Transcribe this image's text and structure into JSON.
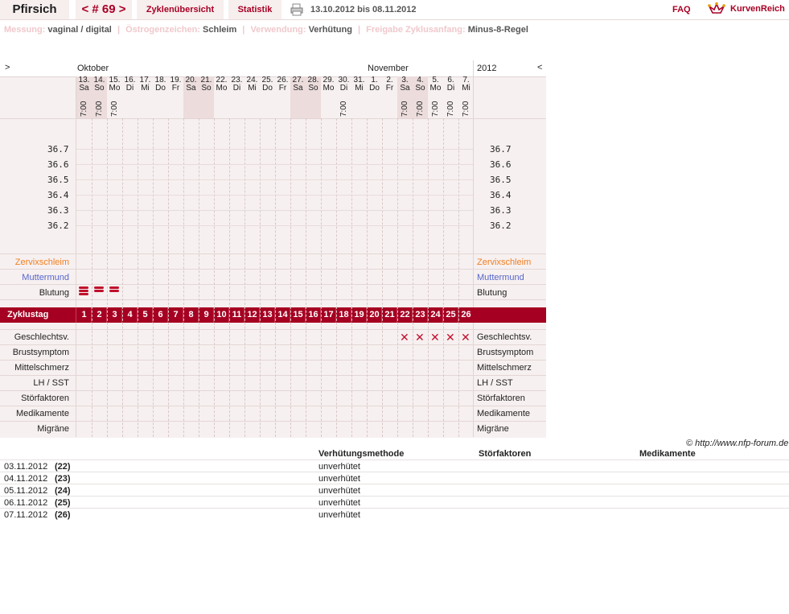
{
  "header": {
    "user": "Pfirsich",
    "cycle": "< # 69 >",
    "tab_overview": "Zyklenübersicht",
    "tab_stats": "Statistik",
    "date_range": "13.10.2012 bis 08.11.2012",
    "faq": "FAQ",
    "brand": "KurvenReich"
  },
  "meta": {
    "messung_label": "Messung:",
    "messung_value": "vaginal / digital",
    "oestrogen_label": "Östrogenzeichen:",
    "oestrogen_value": "Schleim",
    "verwendung_label": "Verwendung:",
    "verwendung_value": "Verhütung",
    "freigabe_label": "Freigabe Zyklusanfang:",
    "freigabe_value": "Minus-8-Regel"
  },
  "chart": {
    "nav_prev": ">",
    "nav_next": "<",
    "month1": "Oktober",
    "month2": "November",
    "year": "2012",
    "days": [
      {
        "d": "13.",
        "w": "Sa",
        "t": "7:00",
        "we": true
      },
      {
        "d": "14.",
        "w": "So",
        "t": "7:00",
        "we": true
      },
      {
        "d": "15.",
        "w": "Mo",
        "t": "7:00",
        "we": false
      },
      {
        "d": "16.",
        "w": "Di",
        "t": "",
        "we": false
      },
      {
        "d": "17.",
        "w": "Mi",
        "t": "",
        "we": false
      },
      {
        "d": "18.",
        "w": "Do",
        "t": "",
        "we": false
      },
      {
        "d": "19.",
        "w": "Fr",
        "t": "",
        "we": false
      },
      {
        "d": "20.",
        "w": "Sa",
        "t": "",
        "we": true
      },
      {
        "d": "21.",
        "w": "So",
        "t": "",
        "we": true
      },
      {
        "d": "22.",
        "w": "Mo",
        "t": "",
        "we": false
      },
      {
        "d": "23.",
        "w": "Di",
        "t": "",
        "we": false
      },
      {
        "d": "24.",
        "w": "Mi",
        "t": "",
        "we": false
      },
      {
        "d": "25.",
        "w": "Do",
        "t": "",
        "we": false
      },
      {
        "d": "26.",
        "w": "Fr",
        "t": "",
        "we": false
      },
      {
        "d": "27.",
        "w": "Sa",
        "t": "",
        "we": true
      },
      {
        "d": "28.",
        "w": "So",
        "t": "",
        "we": true
      },
      {
        "d": "29.",
        "w": "Mo",
        "t": "",
        "we": false
      },
      {
        "d": "30.",
        "w": "Di",
        "t": "7:00",
        "we": false
      },
      {
        "d": "31.",
        "w": "Mi",
        "t": "",
        "we": false
      },
      {
        "d": "1.",
        "w": "Do",
        "t": "",
        "we": false
      },
      {
        "d": "2.",
        "w": "Fr",
        "t": "",
        "we": false
      },
      {
        "d": "3.",
        "w": "Sa",
        "t": "7:00",
        "we": true
      },
      {
        "d": "4.",
        "w": "So",
        "t": "7:00",
        "we": true
      },
      {
        "d": "5.",
        "w": "Mo",
        "t": "7:00",
        "we": false
      },
      {
        "d": "6.",
        "w": "Di",
        "t": "7:00",
        "we": false
      },
      {
        "d": "7.",
        "w": "Mi",
        "t": "7:00",
        "we": false
      }
    ],
    "temps": [
      "36.7",
      "36.6",
      "36.5",
      "36.4",
      "36.3",
      "36.2"
    ],
    "zervix_label": "Zervixschleim",
    "muttermund_label": "Muttermund",
    "blutung_label": "Blutung",
    "zyklustag_label": "Zyklustag",
    "cycle_days": [
      "1",
      "2",
      "3",
      "4",
      "5",
      "6",
      "7",
      "8",
      "9",
      "10",
      "11",
      "12",
      "13",
      "14",
      "15",
      "16",
      "17",
      "18",
      "19",
      "20",
      "21",
      "22",
      "23",
      "24",
      "25",
      "26"
    ],
    "bleeding_days": [
      1,
      2,
      3
    ],
    "bleeding_intensity": [
      3,
      2,
      2
    ],
    "sex_days": [
      22,
      23,
      24,
      25,
      26
    ],
    "rows_lower": [
      "Geschlechtsv.",
      "Brustsymptom",
      "Mittelschmerz",
      "LH / SST",
      "Störfaktoren",
      "Medikamente",
      "Migräne"
    ]
  },
  "copyright": "© http://www.nfp-forum.de",
  "table": {
    "col_method": "Verhütungsmethode",
    "col_stoer": "Störfaktoren",
    "col_med": "Medikamente",
    "rows": [
      {
        "date": "03.11.2012",
        "day": "(22)",
        "method": "unverhütet"
      },
      {
        "date": "04.11.2012",
        "day": "(23)",
        "method": "unverhütet"
      },
      {
        "date": "05.11.2012",
        "day": "(24)",
        "method": "unverhütet"
      },
      {
        "date": "06.11.2012",
        "day": "(25)",
        "method": "unverhütet"
      },
      {
        "date": "07.11.2012",
        "day": "(26)",
        "method": "unverhütet"
      }
    ]
  },
  "colors": {
    "accent": "#a50021",
    "zervix": "#f07f20",
    "muttermund": "#5566cc",
    "blood": "#c0102c"
  }
}
